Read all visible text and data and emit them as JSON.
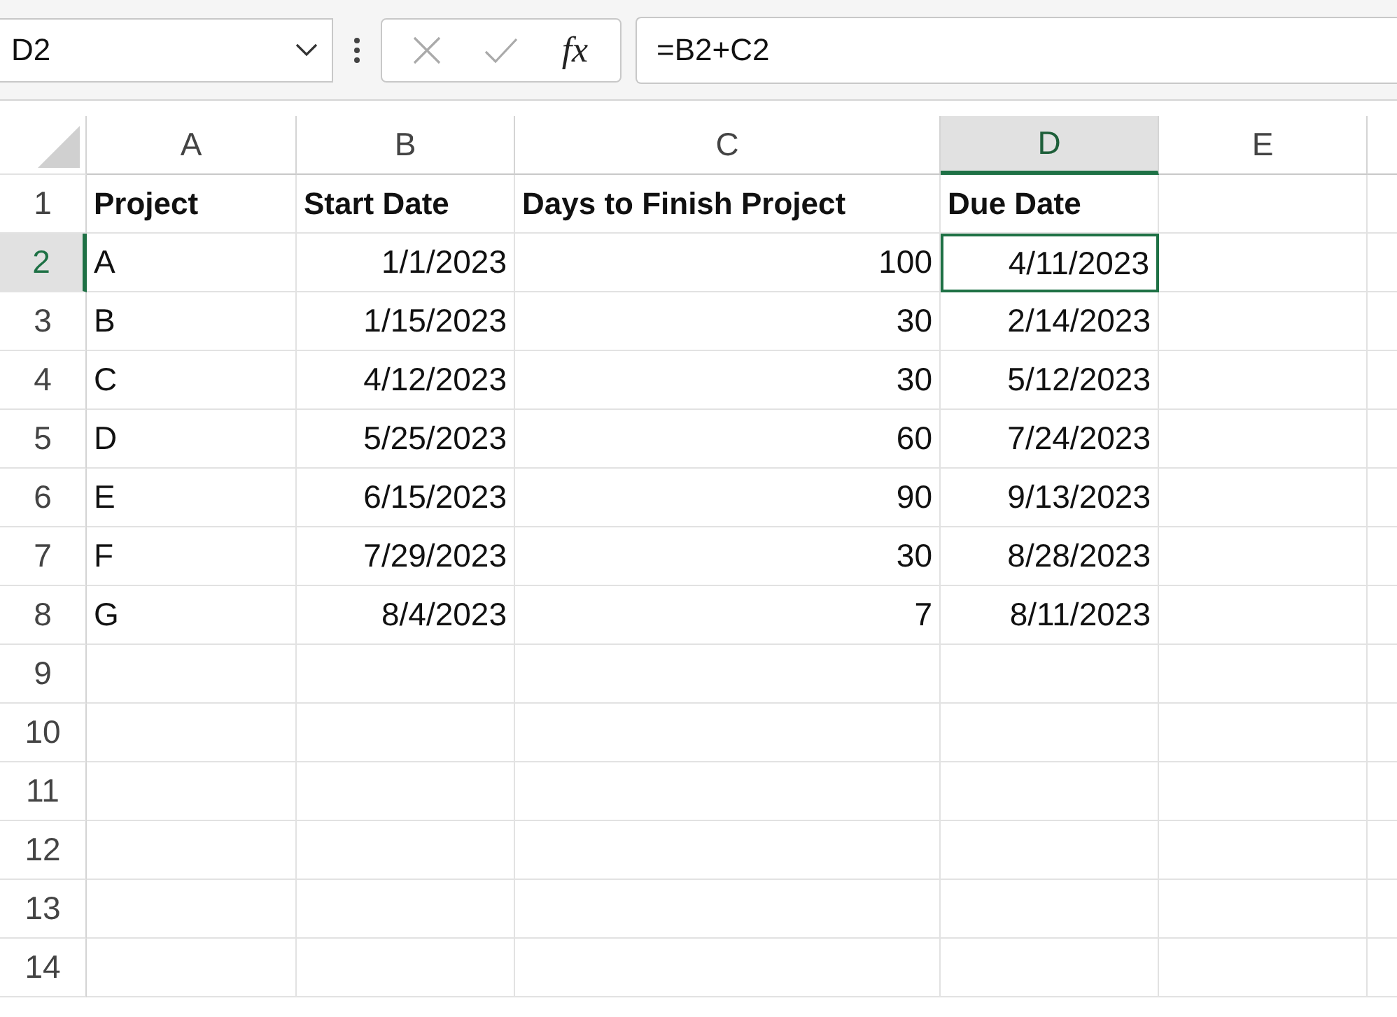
{
  "name_box": {
    "value": "D2"
  },
  "formula_bar": {
    "function_label": "fx",
    "formula": "=B2+C2"
  },
  "columns": [
    {
      "label": "A",
      "selected": false
    },
    {
      "label": "B",
      "selected": false
    },
    {
      "label": "C",
      "selected": false
    },
    {
      "label": "D",
      "selected": true
    },
    {
      "label": "E",
      "selected": false
    }
  ],
  "rows": [
    {
      "number": "1",
      "selected": false,
      "cells": [
        {
          "text": "Project",
          "kind": "header",
          "selected": false
        },
        {
          "text": "Start Date",
          "kind": "header",
          "selected": false
        },
        {
          "text": "Days to Finish Project",
          "kind": "header",
          "selected": false
        },
        {
          "text": "Due Date",
          "kind": "header",
          "selected": false
        }
      ]
    },
    {
      "number": "2",
      "selected": true,
      "cells": [
        {
          "text": "A",
          "kind": "text",
          "selected": false
        },
        {
          "text": "1/1/2023",
          "kind": "number",
          "selected": false
        },
        {
          "text": "100",
          "kind": "number",
          "selected": false
        },
        {
          "text": "4/11/2023",
          "kind": "number",
          "selected": true
        }
      ]
    },
    {
      "number": "3",
      "selected": false,
      "cells": [
        {
          "text": "B",
          "kind": "text",
          "selected": false
        },
        {
          "text": "1/15/2023",
          "kind": "number",
          "selected": false
        },
        {
          "text": "30",
          "kind": "number",
          "selected": false
        },
        {
          "text": "2/14/2023",
          "kind": "number",
          "selected": false
        }
      ]
    },
    {
      "number": "4",
      "selected": false,
      "cells": [
        {
          "text": "C",
          "kind": "text",
          "selected": false
        },
        {
          "text": "4/12/2023",
          "kind": "number",
          "selected": false
        },
        {
          "text": "30",
          "kind": "number",
          "selected": false
        },
        {
          "text": "5/12/2023",
          "kind": "number",
          "selected": false
        }
      ]
    },
    {
      "number": "5",
      "selected": false,
      "cells": [
        {
          "text": "D",
          "kind": "text",
          "selected": false
        },
        {
          "text": "5/25/2023",
          "kind": "number",
          "selected": false
        },
        {
          "text": "60",
          "kind": "number",
          "selected": false
        },
        {
          "text": "7/24/2023",
          "kind": "number",
          "selected": false
        }
      ]
    },
    {
      "number": "6",
      "selected": false,
      "cells": [
        {
          "text": "E",
          "kind": "text",
          "selected": false
        },
        {
          "text": "6/15/2023",
          "kind": "number",
          "selected": false
        },
        {
          "text": "90",
          "kind": "number",
          "selected": false
        },
        {
          "text": "9/13/2023",
          "kind": "number",
          "selected": false
        }
      ]
    },
    {
      "number": "7",
      "selected": false,
      "cells": [
        {
          "text": "F",
          "kind": "text",
          "selected": false
        },
        {
          "text": "7/29/2023",
          "kind": "number",
          "selected": false
        },
        {
          "text": "30",
          "kind": "number",
          "selected": false
        },
        {
          "text": "8/28/2023",
          "kind": "number",
          "selected": false
        }
      ]
    },
    {
      "number": "8",
      "selected": false,
      "cells": [
        {
          "text": "G",
          "kind": "text",
          "selected": false
        },
        {
          "text": "8/4/2023",
          "kind": "number",
          "selected": false
        },
        {
          "text": "7",
          "kind": "number",
          "selected": false
        },
        {
          "text": "8/11/2023",
          "kind": "number",
          "selected": false
        }
      ]
    },
    {
      "number": "9",
      "selected": false
    },
    {
      "number": "10",
      "selected": false
    },
    {
      "number": "11",
      "selected": false
    },
    {
      "number": "12",
      "selected": false
    },
    {
      "number": "13",
      "selected": false
    },
    {
      "number": "14",
      "selected": false
    }
  ]
}
